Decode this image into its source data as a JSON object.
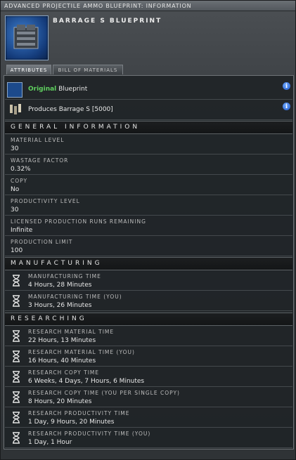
{
  "window": {
    "title": "ADVANCED PROJECTILE AMMO BLUEPRINT: INFORMATION"
  },
  "item": {
    "name": "BARRAGE S BLUEPRINT"
  },
  "tabs": [
    {
      "label": "ATTRIBUTES",
      "active": true
    },
    {
      "label": "BILL OF MATERIALS",
      "active": false
    }
  ],
  "summary": {
    "original_word": "Original",
    "blueprint_word": "Blueprint",
    "produces": "Produces Barrage S [5000]"
  },
  "general": {
    "header": "GENERAL INFORMATION",
    "rows": [
      {
        "label": "MATERIAL LEVEL",
        "value": "30"
      },
      {
        "label": "WASTAGE FACTOR",
        "value": "0.32%"
      },
      {
        "label": "COPY",
        "value": "No"
      },
      {
        "label": "PRODUCTIVITY LEVEL",
        "value": "30"
      },
      {
        "label": "LICENSED PRODUCTION RUNS REMAINING",
        "value": "Infinite"
      },
      {
        "label": "PRODUCTION LIMIT",
        "value": "100"
      }
    ]
  },
  "manufacturing": {
    "header": "MANUFACTURING",
    "rows": [
      {
        "label": "MANUFACTURING TIME",
        "value": "4 Hours, 28 Minutes"
      },
      {
        "label": "MANUFACTURING TIME (YOU)",
        "value": "3 Hours, 26 Minutes"
      }
    ]
  },
  "researching": {
    "header": "RESEARCHING",
    "rows": [
      {
        "label": "RESEARCH MATERIAL TIME",
        "value": "22 Hours, 13 Minutes"
      },
      {
        "label": "RESEARCH MATERIAL TIME (YOU)",
        "value": "16 Hours, 40 Minutes"
      },
      {
        "label": "RESEARCH COPY TIME",
        "value": "6 Weeks, 4 Days, 7 Hours, 6 Minutes"
      },
      {
        "label": "RESEARCH COPY TIME (YOU PER SINGLE COPY)",
        "value": "8 Hours, 20 Minutes"
      },
      {
        "label": "RESEARCH PRODUCTIVITY TIME",
        "value": "1 Day, 9 Hours, 20 Minutes"
      },
      {
        "label": "RESEARCH PRODUCTIVITY TIME (YOU)",
        "value": "1 Day, 1 Hour"
      }
    ]
  },
  "colors": {
    "original": "#5fd05f",
    "info": "#1f58c7",
    "icon_bg": "#143b7a"
  }
}
